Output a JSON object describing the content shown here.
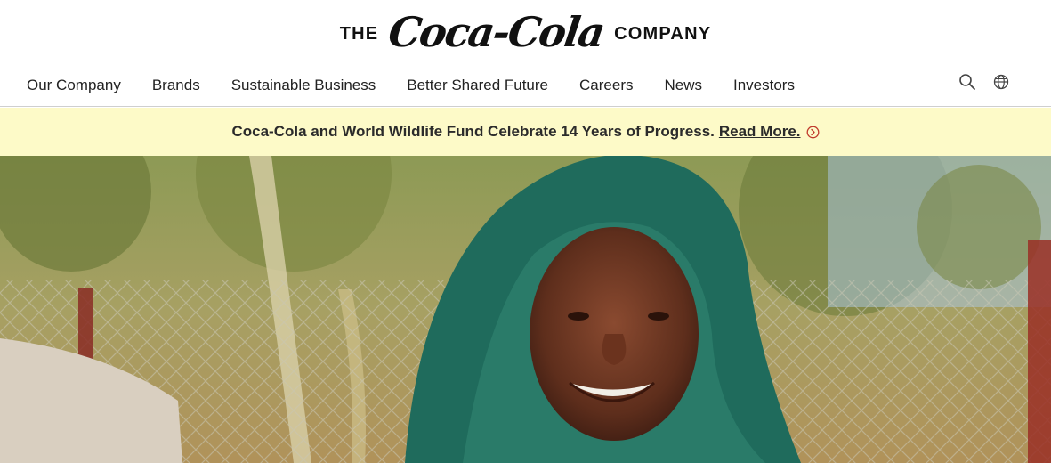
{
  "header": {
    "logo_left": "THE",
    "logo_script": "Coca-Cola",
    "logo_right": "COMPANY"
  },
  "nav": {
    "items": [
      {
        "label": "Our Company"
      },
      {
        "label": "Brands"
      },
      {
        "label": "Sustainable Business"
      },
      {
        "label": "Better Shared Future"
      },
      {
        "label": "Careers"
      },
      {
        "label": "News"
      },
      {
        "label": "Investors"
      }
    ],
    "icons": [
      "search-icon",
      "globe-icon"
    ]
  },
  "banner": {
    "text": "Coca-Cola and World Wildlife Fund Celebrate 14 Years of Progress.",
    "link": "Read More.",
    "icon": "circle-chevron-right-icon",
    "background": "#fdfac8",
    "icon_color": "#c0392b"
  },
  "hero": {
    "image": "smiling woman in green headscarf outdoors"
  }
}
